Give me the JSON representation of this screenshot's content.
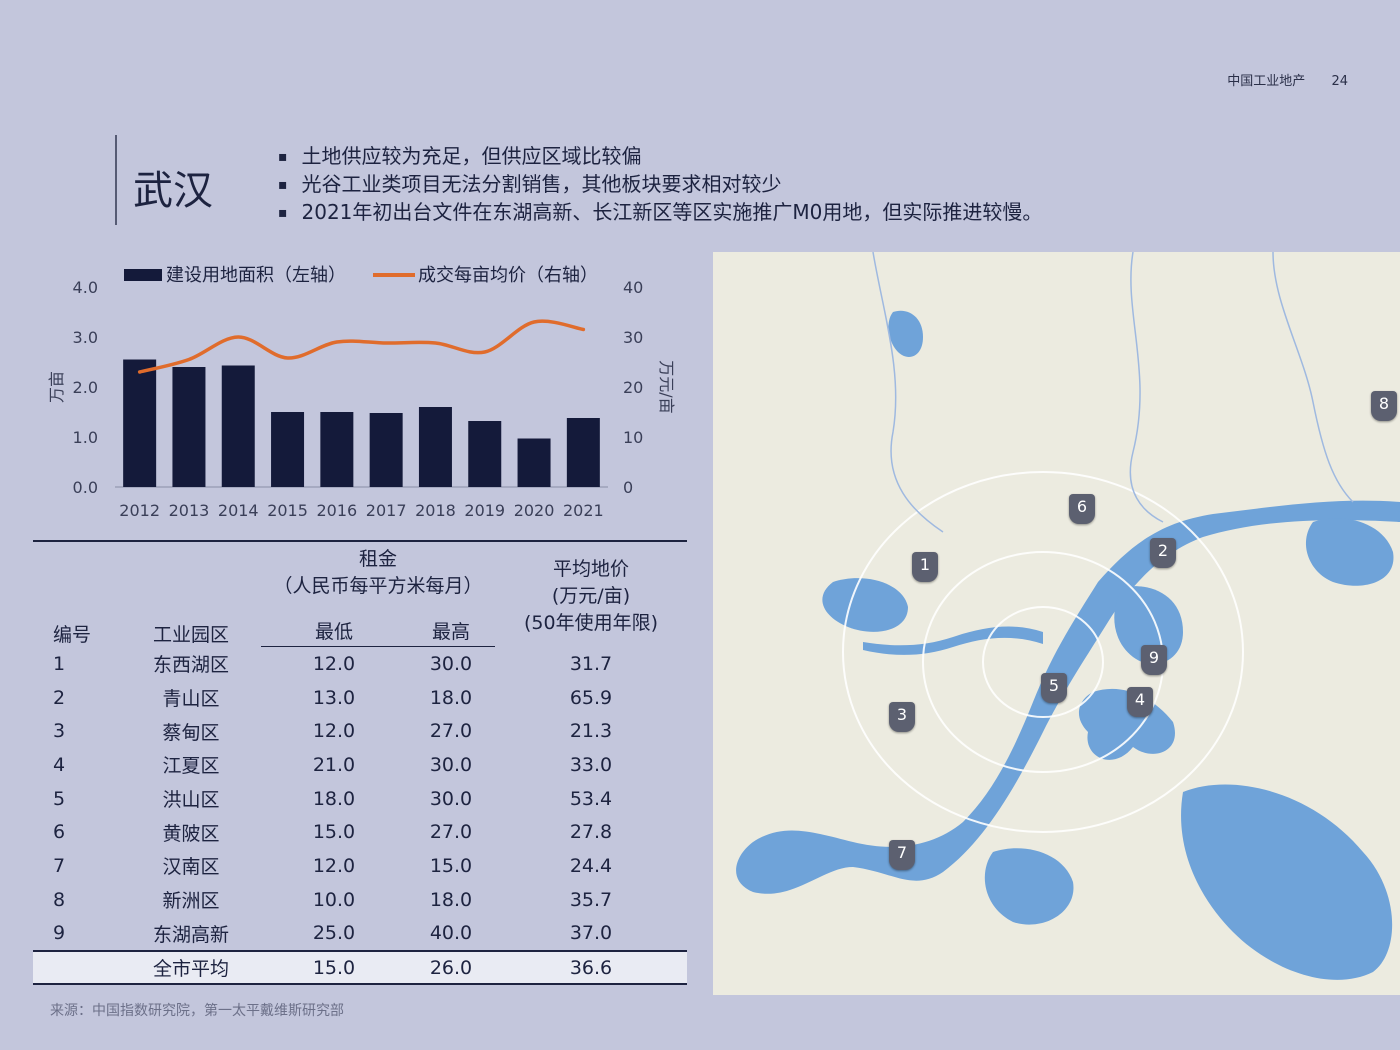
{
  "header": {
    "title": "中国工业地产",
    "page": "24"
  },
  "city": "武汉",
  "bullets": [
    "土地供应较为充足，但供应区域比较偏",
    "光谷工业类项目无法分割销售，其他板块要求相对较少",
    "2021年初出台文件在东湖高新、长江新区等区实施推广M0用地，但实际推进较慢。"
  ],
  "chart_data": {
    "type": "bar",
    "categories": [
      "2012",
      "2013",
      "2014",
      "2015",
      "2016",
      "2017",
      "2018",
      "2019",
      "2020",
      "2021"
    ],
    "series": [
      {
        "name": "建设用地面积（左轴）",
        "type": "bar",
        "axis": "left",
        "color": "#141a3a",
        "values": [
          2.55,
          2.4,
          2.43,
          1.5,
          1.5,
          1.48,
          1.6,
          1.32,
          0.97,
          1.38
        ]
      },
      {
        "name": "成交每亩均价（右轴）",
        "type": "line",
        "axis": "right",
        "color": "#e06c2c",
        "values": [
          23,
          25.5,
          30,
          25.8,
          29,
          28.8,
          28.8,
          27,
          33,
          31.5
        ]
      }
    ],
    "ylabel": "万亩",
    "y2label": "万元/亩",
    "ylim": [
      0,
      4
    ],
    "y2lim": [
      0,
      40
    ],
    "yticks": [
      "0.0",
      "1.0",
      "2.0",
      "3.0",
      "4.0"
    ],
    "y2ticks": [
      "0",
      "10",
      "20",
      "30",
      "40"
    ],
    "legend": "top"
  },
  "table": {
    "headers": {
      "id": "编号",
      "park": "工业园区",
      "rent": "租金",
      "rent_sub": "（人民币每平方米每月）",
      "low": "最低",
      "high": "最高",
      "price": "平均地价",
      "price_unit": "(万元/亩)",
      "price_sub": "(50年使用年限)"
    },
    "rows": [
      {
        "id": "1",
        "park": "东西湖区",
        "low": "12.0",
        "high": "30.0",
        "price": "31.7"
      },
      {
        "id": "2",
        "park": "青山区",
        "low": "13.0",
        "high": "18.0",
        "price": "65.9"
      },
      {
        "id": "3",
        "park": "蔡甸区",
        "low": "12.0",
        "high": "27.0",
        "price": "21.3"
      },
      {
        "id": "4",
        "park": "江夏区",
        "low": "21.0",
        "high": "30.0",
        "price": "33.0"
      },
      {
        "id": "5",
        "park": "洪山区",
        "low": "18.0",
        "high": "30.0",
        "price": "53.4"
      },
      {
        "id": "6",
        "park": "黄陂区",
        "low": "15.0",
        "high": "27.0",
        "price": "27.8"
      },
      {
        "id": "7",
        "park": "汉南区",
        "low": "12.0",
        "high": "15.0",
        "price": "24.4"
      },
      {
        "id": "8",
        "park": "新洲区",
        "low": "10.0",
        "high": "18.0",
        "price": "35.7"
      },
      {
        "id": "9",
        "park": "东湖高新",
        "low": "25.0",
        "high": "40.0",
        "price": "37.0"
      }
    ],
    "average": {
      "park": "全市平均",
      "low": "15.0",
      "high": "26.0",
      "price": "36.6"
    }
  },
  "source": "来源：中国指数研究院，第一太平戴维斯研究部",
  "map": {
    "pins": [
      "1",
      "2",
      "3",
      "4",
      "5",
      "6",
      "7",
      "8",
      "9"
    ],
    "colors": {
      "land": "#ecebe0",
      "water": "#6fa3d9",
      "pin": "#5c6070"
    }
  }
}
